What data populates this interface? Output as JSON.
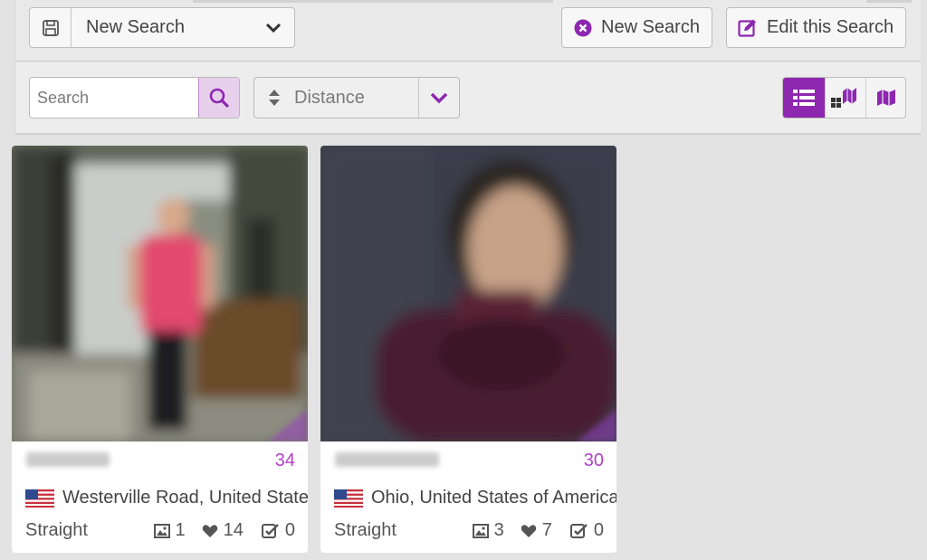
{
  "header": {
    "saved_search_label": "New Search",
    "new_search_label": "New Search",
    "edit_search_label": "Edit this Search"
  },
  "toolbar": {
    "search_placeholder": "Search",
    "sort_label": "Distance"
  },
  "colors": {
    "accent": "#8d27b0",
    "age": "#b23fc7"
  },
  "icons": {
    "save": "floppy-disk-icon",
    "close": "close-circle-icon",
    "edit": "edit-square-icon",
    "search": "magnifier-icon",
    "sort": "sort-icon",
    "list_view": "list-icon",
    "grid_map_view": "grid-map-icon",
    "map_view": "map-icon",
    "photos": "image-icon",
    "likes": "heart-icon",
    "checks": "check-square-icon"
  },
  "profiles": [
    {
      "age": "34",
      "location": "Westerville Road, United States",
      "orientation": "Straight",
      "photos": "1",
      "likes": "14",
      "checks": "0"
    },
    {
      "age": "30",
      "location": "Ohio, United States of America",
      "orientation": "Straight",
      "photos": "3",
      "likes": "7",
      "checks": "0"
    }
  ]
}
